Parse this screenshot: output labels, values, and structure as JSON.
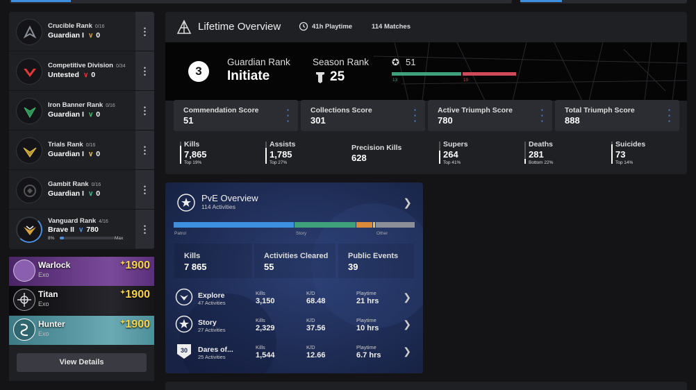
{
  "ranks": [
    {
      "title": "Crucible Rank",
      "progress": "0/16",
      "rank": "Guardian I",
      "value": "0",
      "color": "#d7a23a"
    },
    {
      "title": "Competitive Division",
      "progress": "0/34",
      "rank": "Untested",
      "value": "0",
      "color": "#e23838"
    },
    {
      "title": "Iron Banner Rank",
      "progress": "0/16",
      "rank": "Guardian I",
      "value": "0",
      "color": "#3fbf6f"
    },
    {
      "title": "Trials Rank",
      "progress": "0/16",
      "rank": "Guardian I",
      "value": "0",
      "color": "#e5c54a"
    },
    {
      "title": "Gambit Rank",
      "progress": "0/16",
      "rank": "Guardian I",
      "value": "0",
      "color": "#3fbf8f"
    },
    {
      "title": "Vanguard Rank",
      "progress": "4/16",
      "rank": "Brave II",
      "value": "780",
      "color": "#4a8fe0",
      "bar_min": "8%",
      "bar_max": "Max",
      "bar_fraction": 0.08
    }
  ],
  "characters": [
    {
      "class": "Warlock",
      "race": "Exo",
      "light": "1900",
      "color": "#5a2f7a"
    },
    {
      "class": "Titan",
      "race": "Exo",
      "light": "1900",
      "color": "#151518"
    },
    {
      "class": "Hunter",
      "race": "Exo",
      "light": "1900",
      "color": "#4d8f9a"
    }
  ],
  "view_details": "View Details",
  "lifetime": {
    "title": "Lifetime Overview",
    "playtime": "41h Playtime",
    "matches": "114 Matches",
    "guardian_rank_num": "3",
    "guardian_rank_label": "Guardian Rank",
    "guardian_rank_name": "Initiate",
    "season_rank_label": "Season Rank",
    "season_rank_value": "25",
    "power_value": "51",
    "bar_left": "13",
    "bar_right": "10",
    "scores": [
      {
        "label": "Commendation Score",
        "value": "51"
      },
      {
        "label": "Collections Score",
        "value": "301"
      },
      {
        "label": "Active Triumph Score",
        "value": "780"
      },
      {
        "label": "Total Triumph Score",
        "value": "888"
      }
    ],
    "stats": [
      {
        "label": "Kills",
        "value": "7,865",
        "pct": "Top 19%",
        "fill": 0.81
      },
      {
        "label": "Assists",
        "value": "1,785",
        "pct": "Top 27%",
        "fill": 0.73
      },
      {
        "label": "Precision Kills",
        "value": "628",
        "pct": "",
        "fill": 0
      },
      {
        "label": "Supers",
        "value": "264",
        "pct": "Top 41%",
        "fill": 0.59
      },
      {
        "label": "Deaths",
        "value": "281",
        "pct": "Bottom 22%",
        "fill": 0.22
      },
      {
        "label": "Suicides",
        "value": "73",
        "pct": "Top 14%",
        "fill": 0.86
      }
    ]
  },
  "pve": {
    "title": "PvE Overview",
    "subtitle": "114 Activities",
    "legend": [
      "Patrol",
      "Story",
      "Other"
    ],
    "stats": [
      {
        "label": "Kills",
        "value": "7 865"
      },
      {
        "label": "Activities Cleared",
        "value": "55"
      },
      {
        "label": "Public Events",
        "value": "39"
      }
    ],
    "activities": [
      {
        "name": "Explore",
        "sub": "47 Activities",
        "kills": "3,150",
        "kd": "68.48",
        "playtime": "21 hrs",
        "icon": "explore-icon"
      },
      {
        "name": "Story",
        "sub": "27 Activities",
        "kills": "2,329",
        "kd": "37.56",
        "playtime": "10 hrs",
        "icon": "story-icon"
      },
      {
        "name": "Dares of...",
        "sub": "25 Activities",
        "kills": "1,544",
        "kd": "12.66",
        "playtime": "6.7 hrs",
        "icon": "dares-icon"
      }
    ],
    "col_kills": "Kills",
    "col_kd": "K/D",
    "col_playtime": "Playtime",
    "dares_icon_text": "30"
  }
}
